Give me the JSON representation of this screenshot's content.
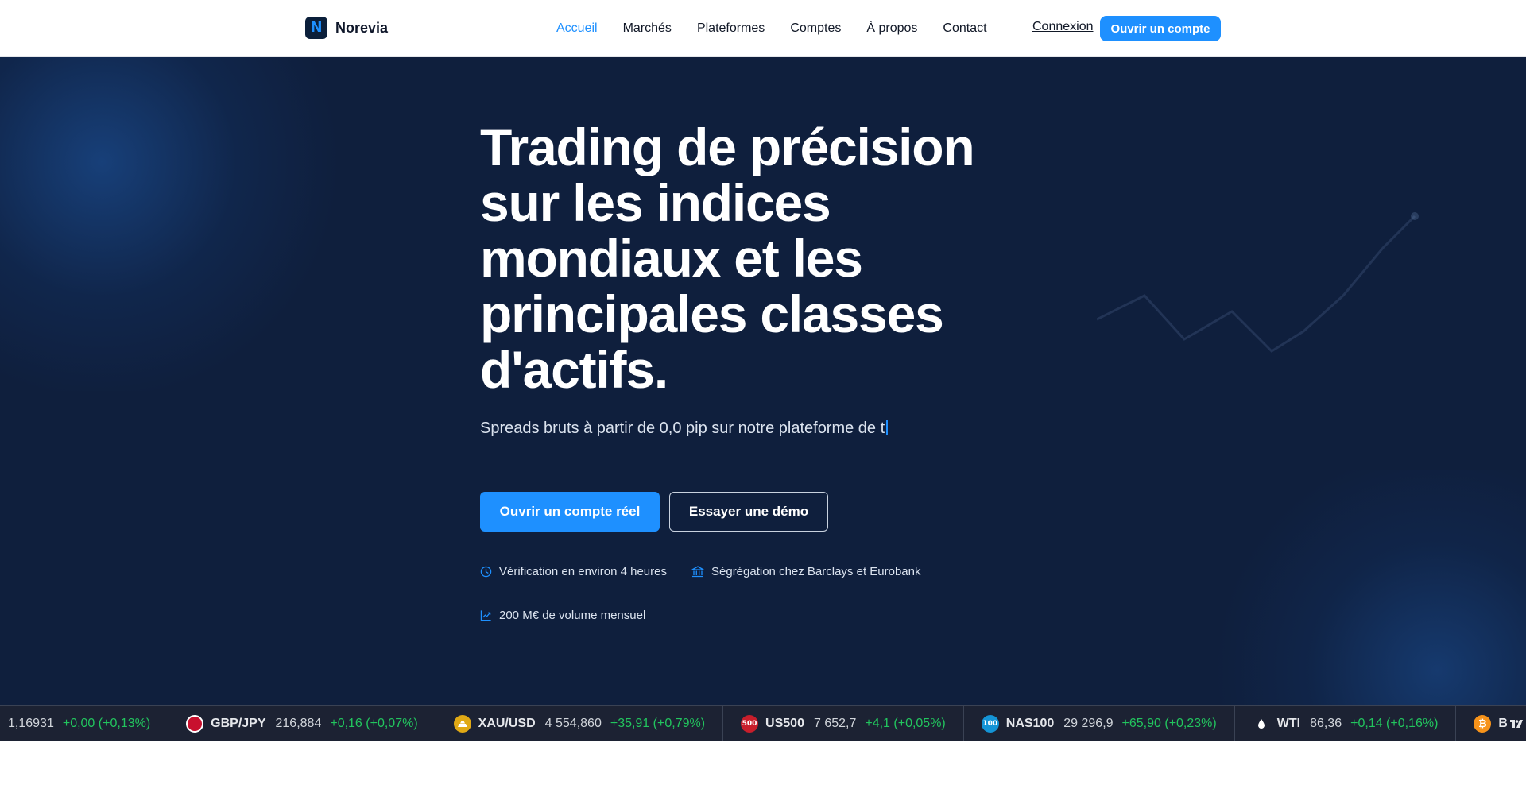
{
  "header": {
    "logo_letter": "N",
    "brand": "Norevia",
    "nav": [
      {
        "label": "Accueil",
        "active": true
      },
      {
        "label": "Marchés",
        "active": false
      },
      {
        "label": "Plateformes",
        "active": false
      },
      {
        "label": "Comptes",
        "active": false
      },
      {
        "label": "À propos",
        "active": false
      },
      {
        "label": "Contact",
        "active": false
      }
    ],
    "login_label": "Connexion",
    "open_account_label": "Ouvrir un compte"
  },
  "hero": {
    "headline_lines": [
      "Trading de précision",
      "sur les indices",
      "mondiaux et les",
      "principales classes",
      "d'actifs."
    ],
    "subline": "Spreads bruts à partir de 0,0 pip sur notre plateforme de t",
    "cta_primary": "Ouvrir un compte réel",
    "cta_secondary": "Essayer une démo",
    "features": [
      {
        "icon": "clock-icon",
        "text": "Vérification en environ 4 heures"
      },
      {
        "icon": "bank-icon",
        "text": "Ségrégation chez Barclays et Eurobank"
      },
      {
        "icon": "trend-up-icon",
        "text": "200 M€ de volume mensuel"
      }
    ]
  },
  "ticker": [
    {
      "symbol": "",
      "icon": "",
      "price": "1,16931",
      "change": "+0,00 (+0,13%)"
    },
    {
      "symbol": "GBP/JPY",
      "icon": "uk-jp-flag-icon",
      "price": "216,884",
      "change": "+0,16 (+0,07%)"
    },
    {
      "symbol": "XAU/USD",
      "icon": "gold-icon",
      "price": "4 554,860",
      "change": "+35,91 (+0,79%)"
    },
    {
      "symbol": "US500",
      "icon": "us500-icon",
      "icon_text": "500",
      "price": "7 652,7",
      "change": "+4,1 (+0,05%)"
    },
    {
      "symbol": "NAS100",
      "icon": "nas100-icon",
      "icon_text": "100",
      "price": "29 296,9",
      "change": "+65,90 (+0,23%)"
    },
    {
      "symbol": "WTI",
      "icon": "oil-drop-icon",
      "price": "86,36",
      "change": "+0,14 (+0,16%)"
    },
    {
      "symbol": "BTC/",
      "icon": "bitcoin-icon",
      "price": "",
      "change": ""
    }
  ],
  "colors": {
    "accent": "#1e90ff",
    "hero_bg": "#0f1f3d",
    "ticker_bg": "#1c2233",
    "positive": "#22c55e"
  }
}
